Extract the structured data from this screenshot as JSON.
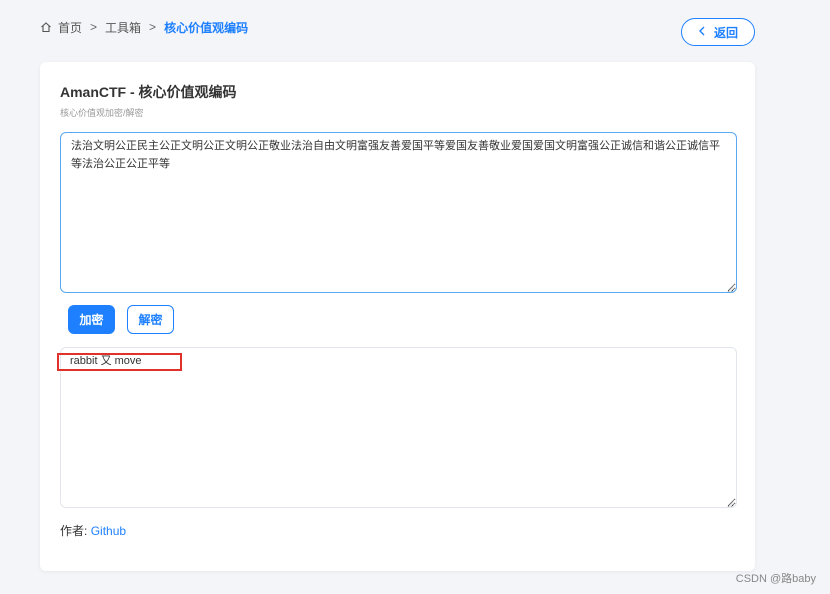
{
  "breadcrumb": {
    "items": [
      "首页",
      "工具箱",
      "核心价值观编码"
    ],
    "separator": ">"
  },
  "back_button": {
    "label": "返回",
    "icon": "chevron-left-icon"
  },
  "card": {
    "title": "AmanCTF - 核心价值观编码",
    "subtitle": "核心价值观加密/解密",
    "input_value": "法治文明公正民主公正文明公正文明公正敬业法治自由文明富强友善爱国平等爱国友善敬业爱国爱国文明富强公正诚信和谐公正诚信平等法治公正公正平等",
    "buttons": {
      "encrypt": "加密",
      "decrypt": "解密"
    },
    "output_value": "rabbit 又 move",
    "author_label": "作者:",
    "author_link": "Github"
  },
  "watermark": "CSDN @路baby",
  "colors": {
    "accent": "#1e80ff",
    "highlight_border": "#e0312b",
    "background": "#f3f5f9"
  }
}
